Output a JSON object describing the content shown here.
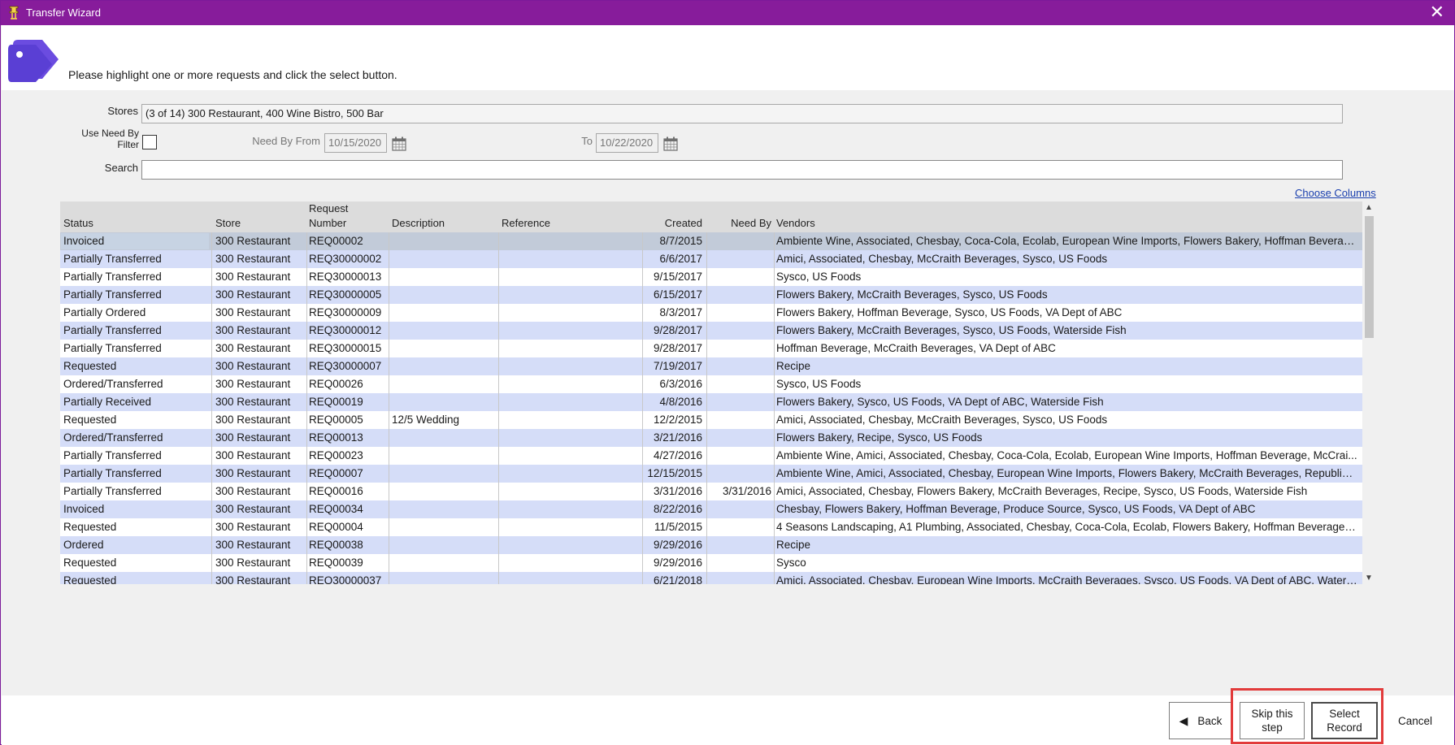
{
  "window": {
    "title": "Transfer Wizard",
    "close_glyph": "✕"
  },
  "header": {
    "instruction": "Please highlight one or more requests and click the select button."
  },
  "filters": {
    "stores_label": "Stores",
    "stores_value": "(3 of 14) 300 Restaurant, 400 Wine Bistro, 500 Bar",
    "use_need_by_label_1": "Use Need By",
    "use_need_by_label_2": "Filter",
    "use_need_by_checked": false,
    "need_by_from_label": "Need By From",
    "need_by_from_value": "10/15/2020",
    "to_label": "To",
    "to_value": "10/22/2020",
    "search_label": "Search",
    "search_value": ""
  },
  "choose_columns": "Choose Columns",
  "table": {
    "headers": {
      "status": "Status",
      "store": "Store",
      "request_number_1": "Request",
      "request_number_2": "Number",
      "description": "Description",
      "reference": "Reference",
      "created": "Created",
      "need_by": "Need By",
      "vendors": "Vendors"
    },
    "rows": [
      {
        "status": "Invoiced",
        "store": "300 Restaurant",
        "request_number": "REQ00002",
        "description": "",
        "reference": "",
        "created": "8/7/2015",
        "need_by": "",
        "vendors": "Ambiente Wine, Associated, Chesbay, Coca-Cola, Ecolab, European Wine Imports, Flowers Bakery, Hoffman Beverag..."
      },
      {
        "status": "Partially Transferred",
        "store": "300 Restaurant",
        "request_number": "REQ30000002",
        "description": "",
        "reference": "",
        "created": "6/6/2017",
        "need_by": "",
        "vendors": "Amici, Associated, Chesbay, McCraith Beverages, Sysco, US Foods"
      },
      {
        "status": "Partially Transferred",
        "store": "300 Restaurant",
        "request_number": "REQ30000013",
        "description": "",
        "reference": "",
        "created": "9/15/2017",
        "need_by": "",
        "vendors": "Sysco, US Foods"
      },
      {
        "status": "Partially Transferred",
        "store": "300 Restaurant",
        "request_number": "REQ30000005",
        "description": "",
        "reference": "",
        "created": "6/15/2017",
        "need_by": "",
        "vendors": "Flowers Bakery, McCraith Beverages, Sysco, US Foods"
      },
      {
        "status": "Partially Ordered",
        "store": "300 Restaurant",
        "request_number": "REQ30000009",
        "description": "",
        "reference": "",
        "created": "8/3/2017",
        "need_by": "",
        "vendors": "Flowers Bakery, Hoffman Beverage, Sysco, US Foods, VA Dept of ABC"
      },
      {
        "status": "Partially Transferred",
        "store": "300 Restaurant",
        "request_number": "REQ30000012",
        "description": "",
        "reference": "",
        "created": "9/28/2017",
        "need_by": "",
        "vendors": "Flowers Bakery, McCraith Beverages, Sysco, US Foods, Waterside Fish"
      },
      {
        "status": "Partially Transferred",
        "store": "300 Restaurant",
        "request_number": "REQ30000015",
        "description": "",
        "reference": "",
        "created": "9/28/2017",
        "need_by": "",
        "vendors": "Hoffman Beverage, McCraith Beverages, VA Dept of ABC"
      },
      {
        "status": "Requested",
        "store": "300 Restaurant",
        "request_number": "REQ30000007",
        "description": "",
        "reference": "",
        "created": "7/19/2017",
        "need_by": "",
        "vendors": "Recipe"
      },
      {
        "status": "Ordered/Transferred",
        "store": "300 Restaurant",
        "request_number": "REQ00026",
        "description": "",
        "reference": "",
        "created": "6/3/2016",
        "need_by": "",
        "vendors": "Sysco, US Foods"
      },
      {
        "status": "Partially Received",
        "store": "300 Restaurant",
        "request_number": "REQ00019",
        "description": "",
        "reference": "",
        "created": "4/8/2016",
        "need_by": "",
        "vendors": "Flowers Bakery, Sysco, US Foods, VA Dept of ABC, Waterside Fish"
      },
      {
        "status": "Requested",
        "store": "300 Restaurant",
        "request_number": "REQ00005",
        "description": "12/5 Wedding",
        "reference": "",
        "created": "12/2/2015",
        "need_by": "",
        "vendors": "Amici, Associated, Chesbay, McCraith Beverages, Sysco, US Foods"
      },
      {
        "status": "Ordered/Transferred",
        "store": "300 Restaurant",
        "request_number": "REQ00013",
        "description": "",
        "reference": "",
        "created": "3/21/2016",
        "need_by": "",
        "vendors": "Flowers Bakery, Recipe, Sysco, US Foods"
      },
      {
        "status": "Partially Transferred",
        "store": "300 Restaurant",
        "request_number": "REQ00023",
        "description": "",
        "reference": "",
        "created": "4/27/2016",
        "need_by": "",
        "vendors": "Ambiente Wine, Amici, Associated, Chesbay, Coca-Cola, Ecolab, European Wine Imports, Hoffman Beverage, McCrai..."
      },
      {
        "status": "Partially Transferred",
        "store": "300 Restaurant",
        "request_number": "REQ00007",
        "description": "",
        "reference": "",
        "created": "12/15/2015",
        "need_by": "",
        "vendors": "Ambiente Wine, Amici, Associated, Chesbay, European Wine Imports, Flowers Bakery, McCraith Beverages, Republic ..."
      },
      {
        "status": "Partially Transferred",
        "store": "300 Restaurant",
        "request_number": "REQ00016",
        "description": "",
        "reference": "",
        "created": "3/31/2016",
        "need_by": "3/31/2016",
        "vendors": "Amici, Associated, Chesbay, Flowers Bakery, McCraith Beverages, Recipe, Sysco, US Foods, Waterside Fish"
      },
      {
        "status": "Invoiced",
        "store": "300 Restaurant",
        "request_number": "REQ00034",
        "description": "",
        "reference": "",
        "created": "8/22/2016",
        "need_by": "",
        "vendors": "Chesbay, Flowers Bakery, Hoffman Beverage, Produce Source, Sysco, US Foods, VA Dept of ABC"
      },
      {
        "status": "Requested",
        "store": "300 Restaurant",
        "request_number": "REQ00004",
        "description": "",
        "reference": "",
        "created": "11/5/2015",
        "need_by": "",
        "vendors": "4 Seasons Landscaping, A1 Plumbing, Associated, Chesbay, Coca-Cola, Ecolab, Flowers Bakery, Hoffman Beverage, ..."
      },
      {
        "status": "Ordered",
        "store": "300 Restaurant",
        "request_number": "REQ00038",
        "description": "",
        "reference": "",
        "created": "9/29/2016",
        "need_by": "",
        "vendors": "Recipe"
      },
      {
        "status": "Requested",
        "store": "300 Restaurant",
        "request_number": "REQ00039",
        "description": "",
        "reference": "",
        "created": "9/29/2016",
        "need_by": "",
        "vendors": "Sysco"
      },
      {
        "status": "Requested",
        "store": "300 Restaurant",
        "request_number": "REQ30000037",
        "description": "",
        "reference": "",
        "created": "6/21/2018",
        "need_by": "",
        "vendors": "Amici, Associated, Chesbay, European Wine Imports, McCraith Beverages, Sysco, US Foods, VA Dept of ABC, Waters..."
      }
    ]
  },
  "footer": {
    "back_label": "Back",
    "back_glyph": "◀",
    "skip_label_1": "Skip this",
    "skip_label_2": "step",
    "select_label_1": "Select",
    "select_label_2": "Record",
    "cancel_label": "Cancel"
  },
  "colors": {
    "titlebar": "#871c9b",
    "row_alt": "#d5ddf8",
    "highlight_box": "#e23b3b",
    "link": "#1a3fae"
  },
  "icons": {
    "app": "app-logo-icon",
    "header": "price-tags-icon",
    "calendar": "calendar-icon",
    "close": "close-icon",
    "back": "back-arrow-icon"
  }
}
